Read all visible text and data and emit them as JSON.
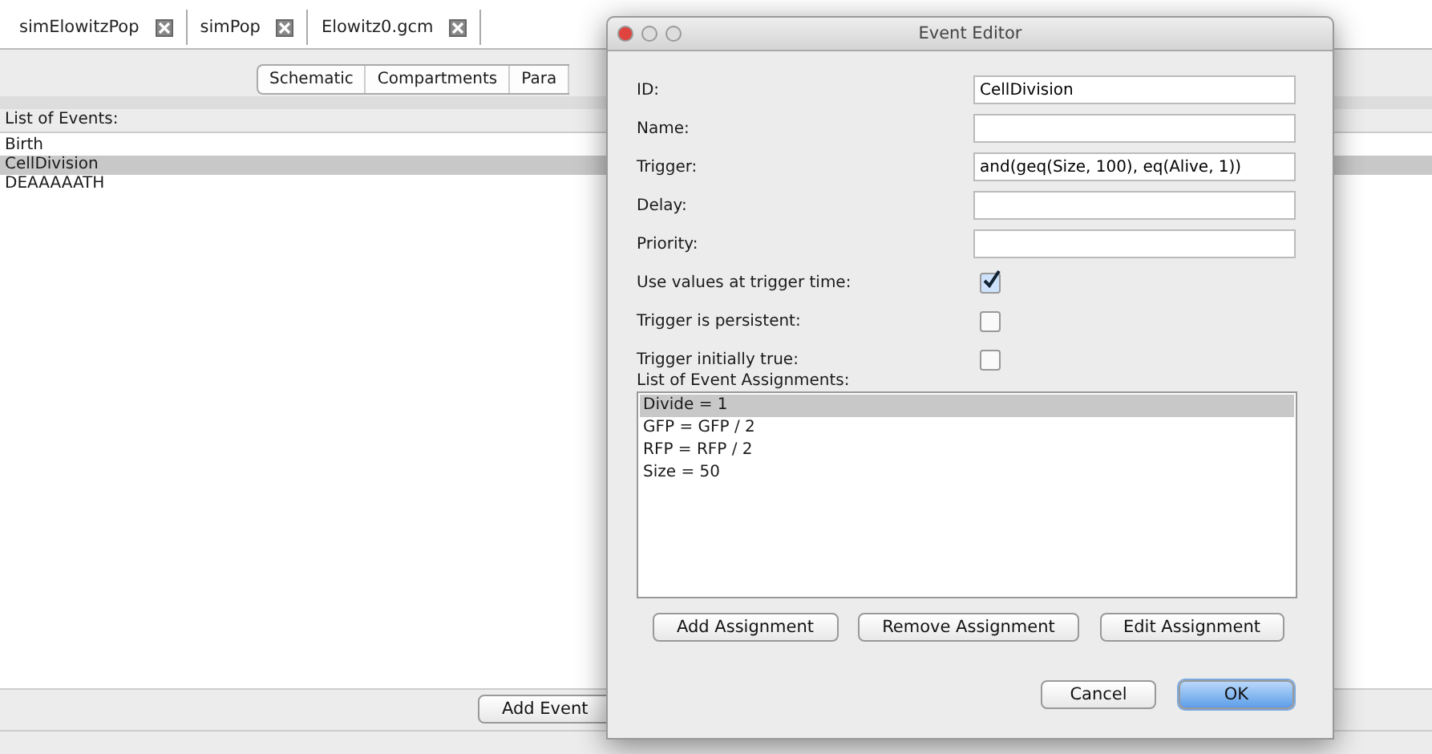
{
  "tabs": [
    {
      "label": "simElowitzPop"
    },
    {
      "label": "simPop"
    },
    {
      "label": "Elowitz0.gcm"
    }
  ],
  "view_tabs": [
    {
      "label": "Schematic"
    },
    {
      "label": "Compartments"
    },
    {
      "label": "Para"
    }
  ],
  "events": {
    "label": "List of Events:",
    "items": [
      {
        "label": "Birth",
        "selected": false
      },
      {
        "label": "CellDivision",
        "selected": true
      },
      {
        "label": "DEAAAAATH",
        "selected": false
      }
    ]
  },
  "add_event": "Add Event",
  "dialog": {
    "title": "Event Editor",
    "fields": [
      {
        "kind": "text",
        "label": "ID:",
        "value": "CellDivision"
      },
      {
        "kind": "text",
        "label": "Name:"
      },
      {
        "kind": "text",
        "label": "Trigger:",
        "value": "and(geq(Size, 100), eq(Alive, 1))"
      },
      {
        "kind": "text",
        "label": "Delay:"
      },
      {
        "kind": "text",
        "label": "Priority:"
      },
      {
        "kind": "check",
        "label": "Use values at trigger time:",
        "checked": true
      },
      {
        "kind": "check",
        "label": "Trigger is persistent:",
        "checked": false
      },
      {
        "kind": "check",
        "label": "Trigger initially true:",
        "checked": false
      }
    ],
    "assignments": {
      "label": "List of Event Assignments:",
      "items": [
        {
          "label": "Divide = 1",
          "selected": true
        },
        {
          "label": "GFP = GFP / 2",
          "selected": false
        },
        {
          "label": "RFP = RFP / 2",
          "selected": false
        },
        {
          "label": "Size = 50",
          "selected": false
        }
      ]
    },
    "assignment_buttons": [
      "Add Assignment",
      "Remove Assignment",
      "Edit Assignment"
    ],
    "buttons": [
      {
        "label": "Cancel",
        "default": false
      },
      {
        "label": "OK",
        "default": true
      }
    ]
  }
}
